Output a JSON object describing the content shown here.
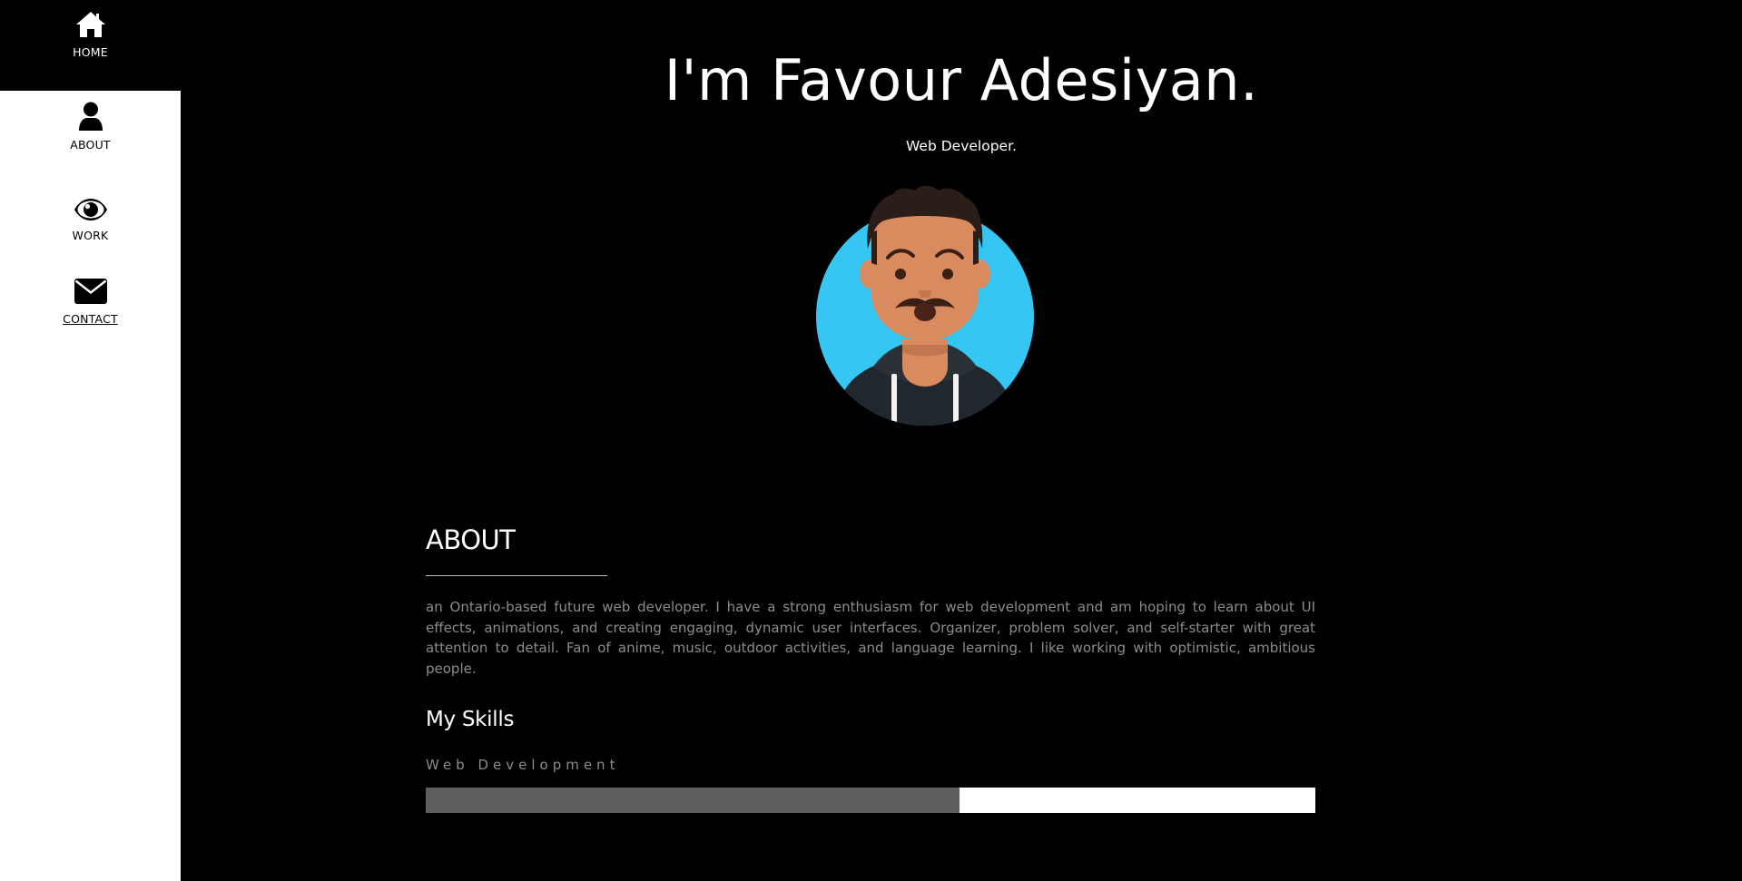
{
  "nav": {
    "home": {
      "label": "HOME",
      "icon": "home-icon"
    },
    "about": {
      "label": "ABOUT",
      "icon": "user-icon"
    },
    "work": {
      "label": "WORK",
      "icon": "eye-icon"
    },
    "contact": {
      "label": "CONTACT",
      "icon": "envelope-icon"
    }
  },
  "hero": {
    "title": "I'm Favour Adesiyan.",
    "subtitle": "Web Developer.",
    "avatar_icon": "avatar-illustration"
  },
  "about": {
    "heading": "ABOUT",
    "text": "an Ontario-based future web developer. I have a strong enthusiasm for web development and am hoping to learn about UI effects, animations, and creating engaging, dynamic user interfaces. Organizer, problem solver, and self-starter with great attention to detail. Fan of anime, music, outdoor activities, and language learning. I like working with optimistic, ambitious people."
  },
  "skills": {
    "heading": "My Skills",
    "items": [
      {
        "name": "Web Development",
        "level": 0.6
      }
    ]
  },
  "colors": {
    "background": "#000000",
    "sidebar": "#ffffff",
    "text_muted": "#8c8c8c",
    "skill_fill": "#5e5e5e",
    "avatar_bg": "#35c6f4"
  }
}
